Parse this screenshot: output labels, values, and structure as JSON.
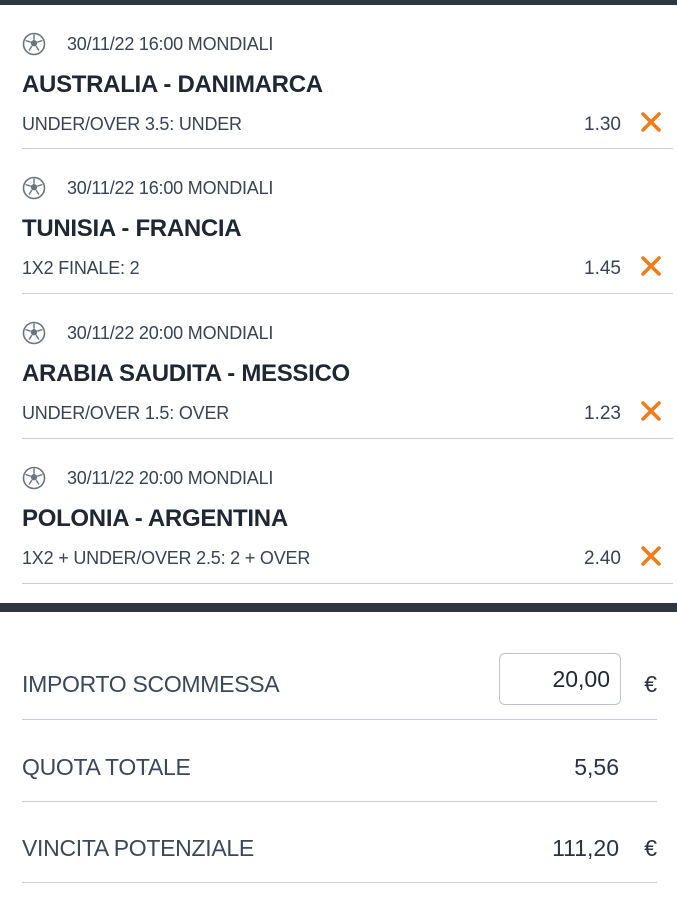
{
  "bets": [
    {
      "datetime": "30/11/22 16:00",
      "competition": "MONDIALI",
      "match": "AUSTRALIA - DANIMARCA",
      "market": "UNDER/OVER 3.5: UNDER",
      "odd": "1.30"
    },
    {
      "datetime": "30/11/22 16:00",
      "competition": "MONDIALI",
      "match": "TUNISIA - FRANCIA",
      "market": "1X2 FINALE: 2",
      "odd": "1.45"
    },
    {
      "datetime": "30/11/22 20:00",
      "competition": "MONDIALI",
      "match": "ARABIA SAUDITA - MESSICO",
      "market": "UNDER/OVER 1.5: OVER",
      "odd": "1.23"
    },
    {
      "datetime": "30/11/22 20:00",
      "competition": "MONDIALI",
      "match": "POLONIA - ARGENTINA",
      "market": "1X2 + UNDER/OVER 2.5: 2 + OVER",
      "odd": "2.40"
    }
  ],
  "summary": {
    "amount_label": "IMPORTO SCOMMESSA",
    "amount_value": "20,00",
    "currency": "€",
    "total_odds_label": "QUOTA TOTALE",
    "total_odds_value": "5,56",
    "potential_win_label": "VINCITA POTENZIALE",
    "potential_win_value": "111,20"
  },
  "icons": {
    "sport": "soccer-ball-icon",
    "remove": "close-icon"
  },
  "colors": {
    "accent": "#f07d1a",
    "dark_bar": "#2f3641",
    "divider": "#c9ced6"
  }
}
